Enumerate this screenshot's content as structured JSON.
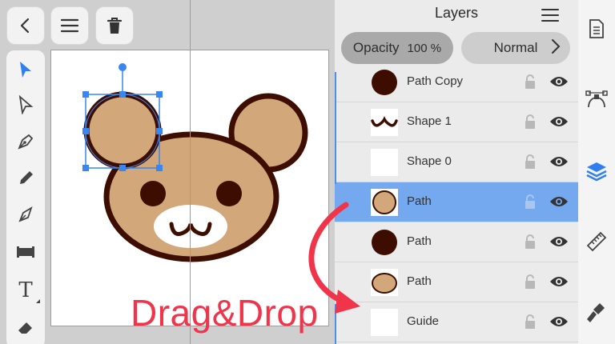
{
  "toolbar": {
    "back_icon": "chevron-left-icon",
    "menu_icon": "hamburger-icon",
    "trash_icon": "trash-icon"
  },
  "tools": [
    "select-arrow-icon",
    "direct-select-icon",
    "pen-tool-icon",
    "pencil-icon",
    "brush-icon",
    "shape-rect-icon",
    "text-tool-icon",
    "eraser-icon"
  ],
  "text_tool_label": "T",
  "panel": {
    "title": "Layers",
    "opacity_label": "Opacity",
    "opacity_value": "100 %",
    "blend_mode": "Normal"
  },
  "layers": [
    {
      "name": "Path Copy",
      "thumb": "dark-circle"
    },
    {
      "name": "Shape 1",
      "thumb": "mouth"
    },
    {
      "name": "Shape 0",
      "thumb": "blank"
    },
    {
      "name": "Path",
      "thumb": "ear-circle",
      "selected": true
    },
    {
      "name": "Path",
      "thumb": "dark-circle"
    },
    {
      "name": "Path",
      "thumb": "head-oval"
    },
    {
      "name": "Guide",
      "thumb": "blank"
    }
  ],
  "rightbar": [
    "document-icon",
    "path-nodes-icon",
    "layers-icon",
    "ruler-icon",
    "paint-brush-icon"
  ],
  "annotation": "Drag&Drop",
  "colors": {
    "accent": "#74a8ef",
    "annotation": "#f0344a",
    "bear_fill": "#d2a87a",
    "bear_outline": "#3d0d00"
  }
}
